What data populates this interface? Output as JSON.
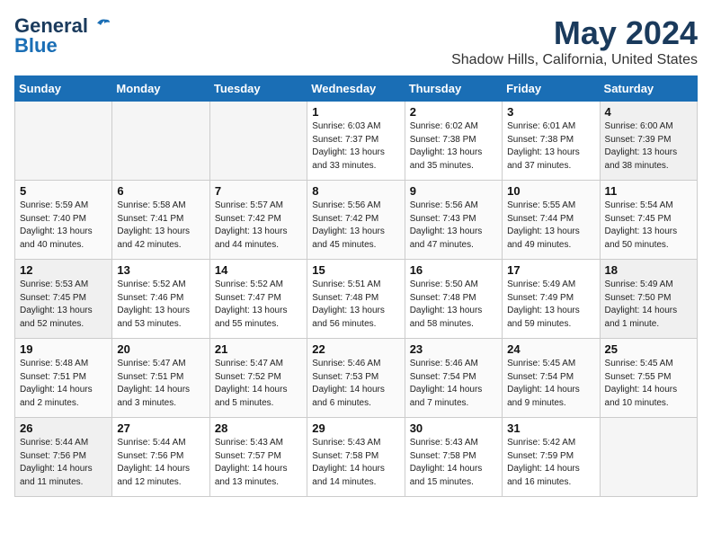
{
  "logo": {
    "line1": "General",
    "line2": "Blue"
  },
  "title": "May 2024",
  "location": "Shadow Hills, California, United States",
  "days_of_week": [
    "Sunday",
    "Monday",
    "Tuesday",
    "Wednesday",
    "Thursday",
    "Friday",
    "Saturday"
  ],
  "weeks": [
    [
      {
        "num": "",
        "info": "",
        "empty": true
      },
      {
        "num": "",
        "info": "",
        "empty": true
      },
      {
        "num": "",
        "info": "",
        "empty": true
      },
      {
        "num": "1",
        "info": "Sunrise: 6:03 AM\nSunset: 7:37 PM\nDaylight: 13 hours\nand 33 minutes.",
        "empty": false
      },
      {
        "num": "2",
        "info": "Sunrise: 6:02 AM\nSunset: 7:38 PM\nDaylight: 13 hours\nand 35 minutes.",
        "empty": false
      },
      {
        "num": "3",
        "info": "Sunrise: 6:01 AM\nSunset: 7:38 PM\nDaylight: 13 hours\nand 37 minutes.",
        "empty": false
      },
      {
        "num": "4",
        "info": "Sunrise: 6:00 AM\nSunset: 7:39 PM\nDaylight: 13 hours\nand 38 minutes.",
        "empty": false
      }
    ],
    [
      {
        "num": "5",
        "info": "Sunrise: 5:59 AM\nSunset: 7:40 PM\nDaylight: 13 hours\nand 40 minutes.",
        "empty": false
      },
      {
        "num": "6",
        "info": "Sunrise: 5:58 AM\nSunset: 7:41 PM\nDaylight: 13 hours\nand 42 minutes.",
        "empty": false
      },
      {
        "num": "7",
        "info": "Sunrise: 5:57 AM\nSunset: 7:42 PM\nDaylight: 13 hours\nand 44 minutes.",
        "empty": false
      },
      {
        "num": "8",
        "info": "Sunrise: 5:56 AM\nSunset: 7:42 PM\nDaylight: 13 hours\nand 45 minutes.",
        "empty": false
      },
      {
        "num": "9",
        "info": "Sunrise: 5:56 AM\nSunset: 7:43 PM\nDaylight: 13 hours\nand 47 minutes.",
        "empty": false
      },
      {
        "num": "10",
        "info": "Sunrise: 5:55 AM\nSunset: 7:44 PM\nDaylight: 13 hours\nand 49 minutes.",
        "empty": false
      },
      {
        "num": "11",
        "info": "Sunrise: 5:54 AM\nSunset: 7:45 PM\nDaylight: 13 hours\nand 50 minutes.",
        "empty": false
      }
    ],
    [
      {
        "num": "12",
        "info": "Sunrise: 5:53 AM\nSunset: 7:45 PM\nDaylight: 13 hours\nand 52 minutes.",
        "empty": false
      },
      {
        "num": "13",
        "info": "Sunrise: 5:52 AM\nSunset: 7:46 PM\nDaylight: 13 hours\nand 53 minutes.",
        "empty": false
      },
      {
        "num": "14",
        "info": "Sunrise: 5:52 AM\nSunset: 7:47 PM\nDaylight: 13 hours\nand 55 minutes.",
        "empty": false
      },
      {
        "num": "15",
        "info": "Sunrise: 5:51 AM\nSunset: 7:48 PM\nDaylight: 13 hours\nand 56 minutes.",
        "empty": false
      },
      {
        "num": "16",
        "info": "Sunrise: 5:50 AM\nSunset: 7:48 PM\nDaylight: 13 hours\nand 58 minutes.",
        "empty": false
      },
      {
        "num": "17",
        "info": "Sunrise: 5:49 AM\nSunset: 7:49 PM\nDaylight: 13 hours\nand 59 minutes.",
        "empty": false
      },
      {
        "num": "18",
        "info": "Sunrise: 5:49 AM\nSunset: 7:50 PM\nDaylight: 14 hours\nand 1 minute.",
        "empty": false
      }
    ],
    [
      {
        "num": "19",
        "info": "Sunrise: 5:48 AM\nSunset: 7:51 PM\nDaylight: 14 hours\nand 2 minutes.",
        "empty": false
      },
      {
        "num": "20",
        "info": "Sunrise: 5:47 AM\nSunset: 7:51 PM\nDaylight: 14 hours\nand 3 minutes.",
        "empty": false
      },
      {
        "num": "21",
        "info": "Sunrise: 5:47 AM\nSunset: 7:52 PM\nDaylight: 14 hours\nand 5 minutes.",
        "empty": false
      },
      {
        "num": "22",
        "info": "Sunrise: 5:46 AM\nSunset: 7:53 PM\nDaylight: 14 hours\nand 6 minutes.",
        "empty": false
      },
      {
        "num": "23",
        "info": "Sunrise: 5:46 AM\nSunset: 7:54 PM\nDaylight: 14 hours\nand 7 minutes.",
        "empty": false
      },
      {
        "num": "24",
        "info": "Sunrise: 5:45 AM\nSunset: 7:54 PM\nDaylight: 14 hours\nand 9 minutes.",
        "empty": false
      },
      {
        "num": "25",
        "info": "Sunrise: 5:45 AM\nSunset: 7:55 PM\nDaylight: 14 hours\nand 10 minutes.",
        "empty": false
      }
    ],
    [
      {
        "num": "26",
        "info": "Sunrise: 5:44 AM\nSunset: 7:56 PM\nDaylight: 14 hours\nand 11 minutes.",
        "empty": false
      },
      {
        "num": "27",
        "info": "Sunrise: 5:44 AM\nSunset: 7:56 PM\nDaylight: 14 hours\nand 12 minutes.",
        "empty": false
      },
      {
        "num": "28",
        "info": "Sunrise: 5:43 AM\nSunset: 7:57 PM\nDaylight: 14 hours\nand 13 minutes.",
        "empty": false
      },
      {
        "num": "29",
        "info": "Sunrise: 5:43 AM\nSunset: 7:58 PM\nDaylight: 14 hours\nand 14 minutes.",
        "empty": false
      },
      {
        "num": "30",
        "info": "Sunrise: 5:43 AM\nSunset: 7:58 PM\nDaylight: 14 hours\nand 15 minutes.",
        "empty": false
      },
      {
        "num": "31",
        "info": "Sunrise: 5:42 AM\nSunset: 7:59 PM\nDaylight: 14 hours\nand 16 minutes.",
        "empty": false
      },
      {
        "num": "",
        "info": "",
        "empty": true
      }
    ]
  ]
}
